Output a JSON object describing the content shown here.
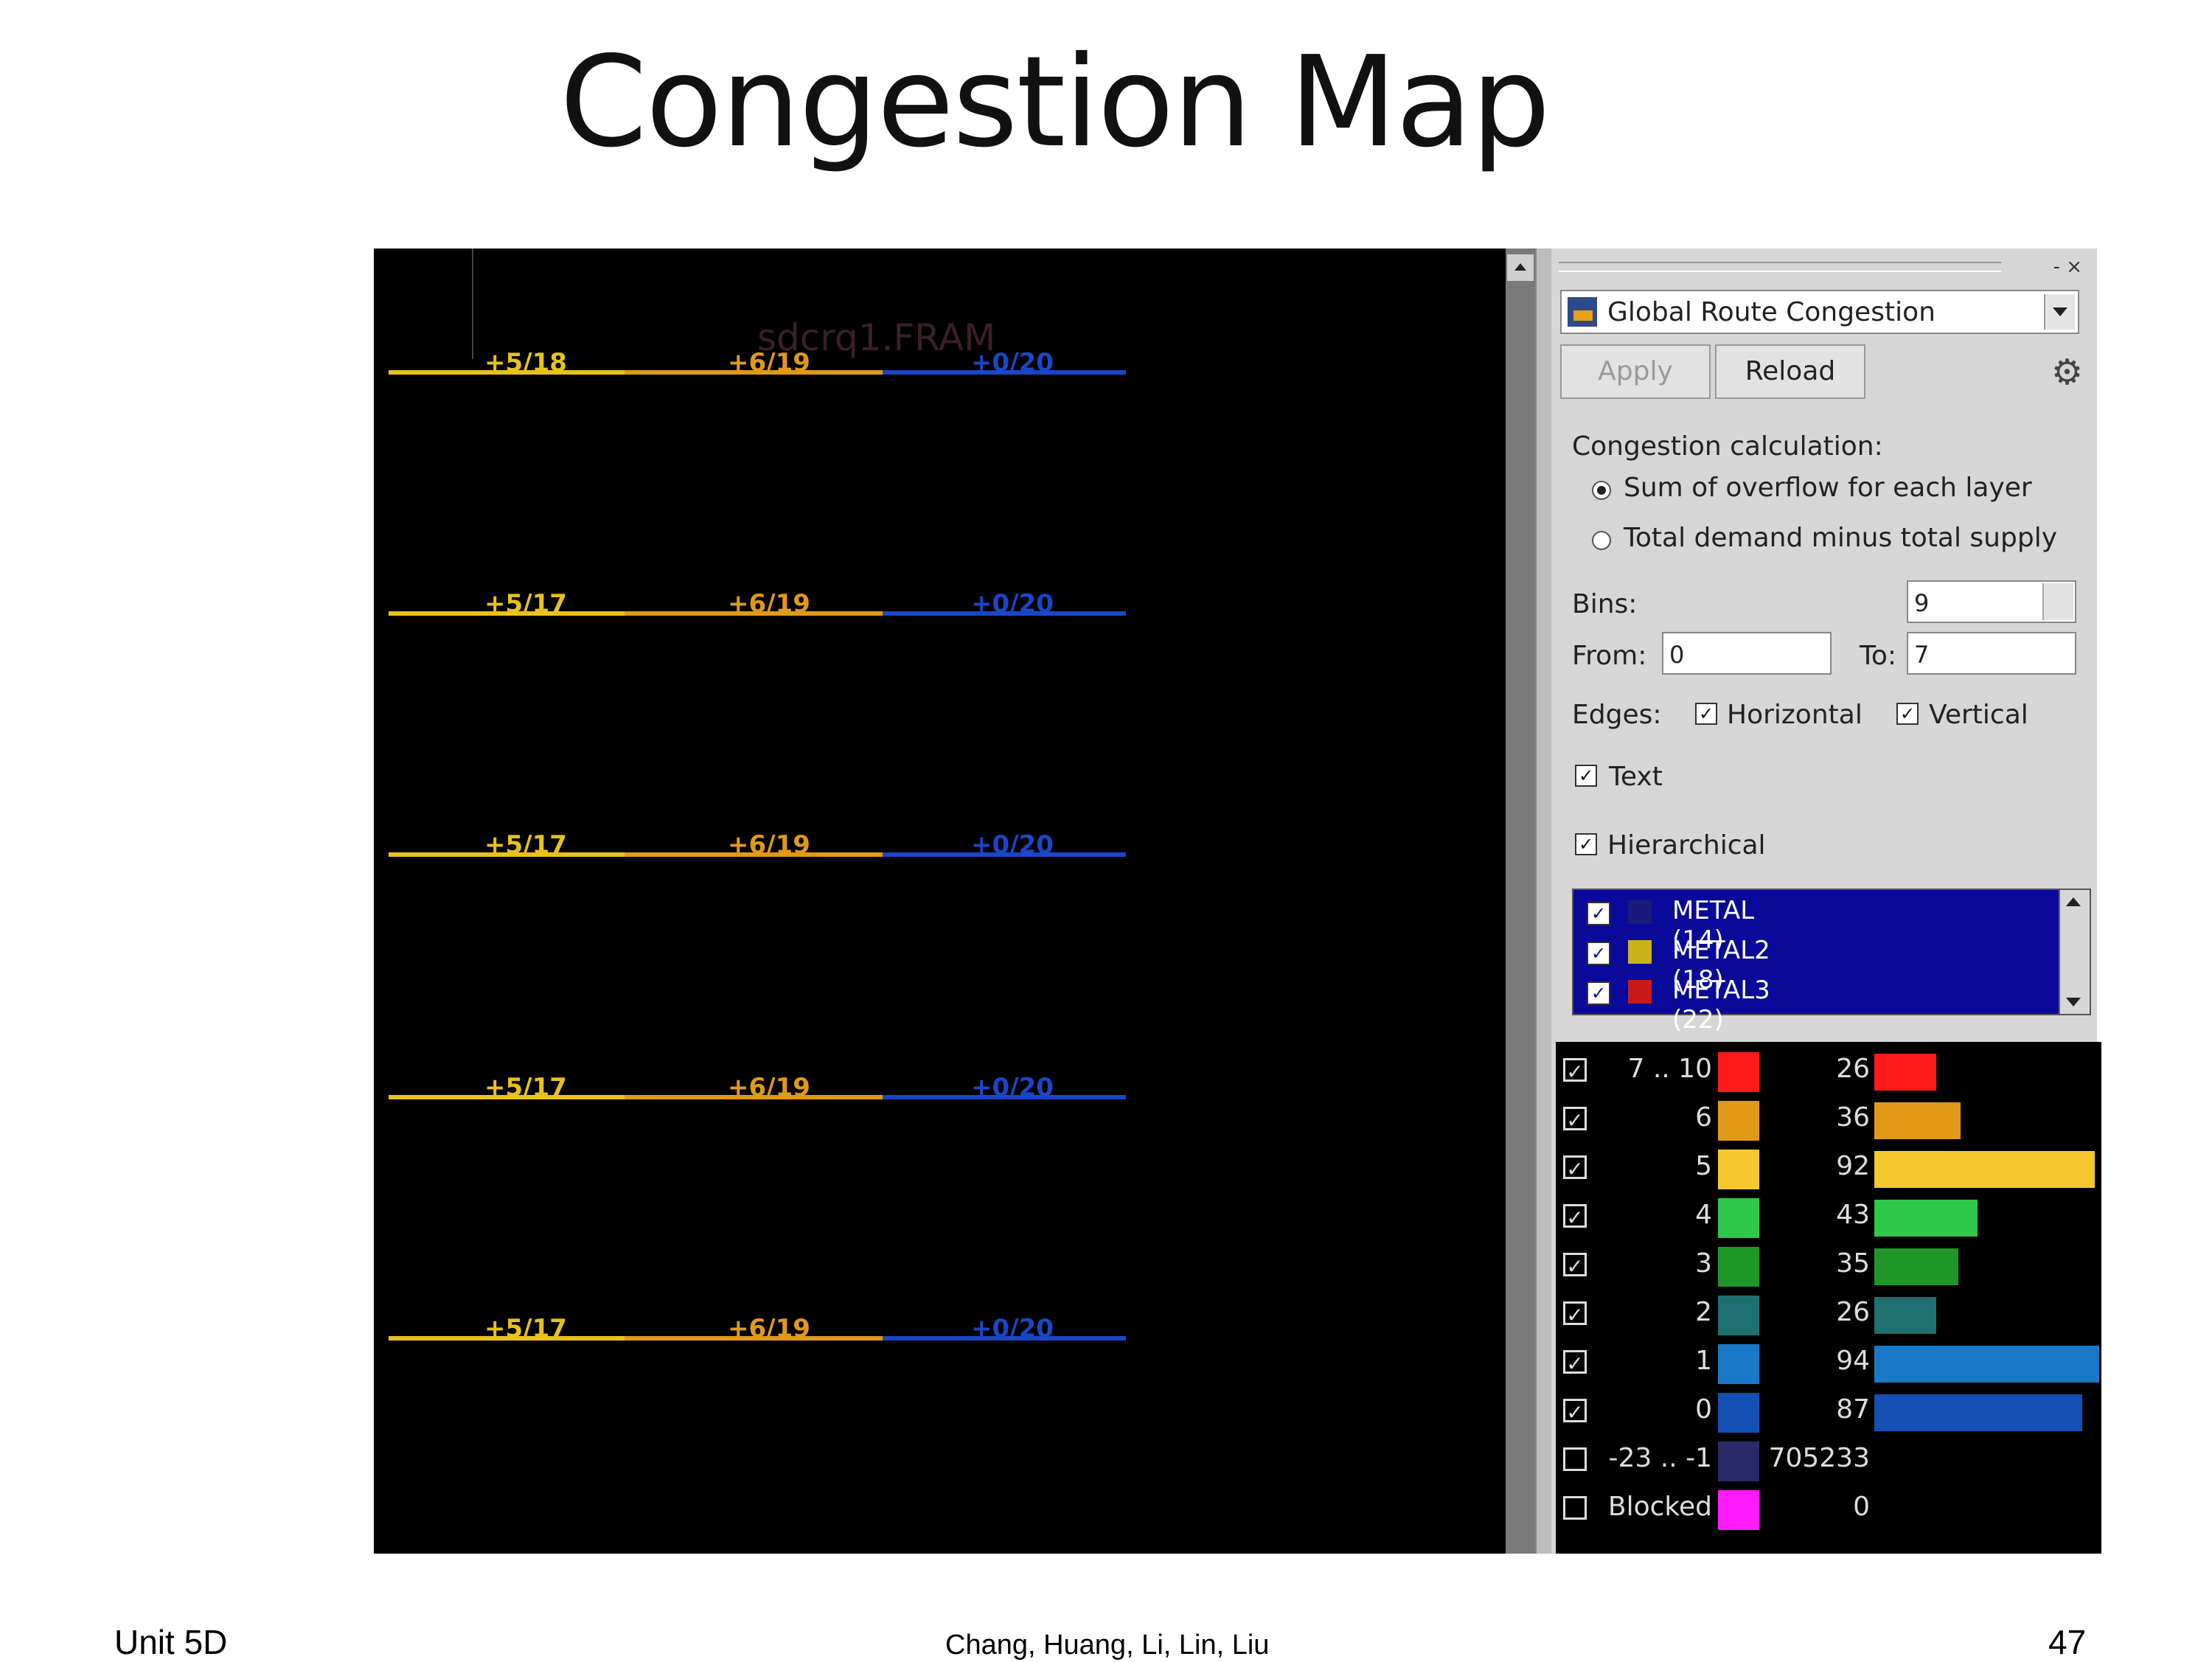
{
  "slide": {
    "title": "Congestion Map",
    "footer_left": "Unit 5D",
    "footer_center": "Chang, Huang, Li, Lin, Liu",
    "page_number": "47"
  },
  "canvas": {
    "cell_label": "sdcrq1.FRAM",
    "rows": [
      {
        "labels": [
          "+5/18",
          "+6/19",
          "+0/20"
        ]
      },
      {
        "labels": [
          "+5/17",
          "+6/19",
          "+0/20"
        ]
      },
      {
        "labels": [
          "+5/17",
          "+6/19",
          "+0/20"
        ]
      },
      {
        "labels": [
          "+5/17",
          "+6/19",
          "+0/20"
        ]
      },
      {
        "labels": [
          "+5/17",
          "+6/19",
          "+0/20"
        ]
      }
    ],
    "segment_colors": [
      "#e8c21a",
      "#e09a18",
      "#1a46c8"
    ]
  },
  "panel": {
    "window_buttons": "- ×",
    "map_select": "Global Route Congestion",
    "apply_label": "Apply",
    "reload_label": "Reload",
    "settings_icon": "gear-icon",
    "calc_heading": "Congestion calculation:",
    "calc_options": [
      "Sum of overflow for each layer",
      "Total demand minus total supply"
    ],
    "calc_selected": 0,
    "bins_label": "Bins:",
    "bins_value": "9",
    "from_label": "From:",
    "from_value": "0",
    "to_label": "To:",
    "to_value": "7",
    "edges_label": "Edges:",
    "horizontal_label": "Horizontal",
    "horizontal_checked": true,
    "vertical_label": "Vertical",
    "vertical_checked": true,
    "text_label": "Text",
    "text_checked": true,
    "hierarchical_label": "Hierarchical",
    "hierarchical_checked": true,
    "layers": [
      {
        "name": "METAL (14)",
        "checked": true,
        "color": "#1a1a7a"
      },
      {
        "name": "METAL2 (18)",
        "checked": true,
        "color": "#c8b41a"
      },
      {
        "name": "METAL3 (22)",
        "checked": true,
        "color": "#c81a1a"
      }
    ]
  },
  "legend": [
    {
      "range": "7 .. 10",
      "count": "26",
      "count_value": 26,
      "color": "#ff1a1a",
      "checked": true
    },
    {
      "range": "6",
      "count": "36",
      "count_value": 36,
      "color": "#e09a18",
      "checked": true
    },
    {
      "range": "5",
      "count": "92",
      "count_value": 92,
      "color": "#f5c830",
      "checked": true
    },
    {
      "range": "4",
      "count": "43",
      "count_value": 43,
      "color": "#2ec84a",
      "checked": true
    },
    {
      "range": "3",
      "count": "35",
      "count_value": 35,
      "color": "#1e9628",
      "checked": true
    },
    {
      "range": "2",
      "count": "26",
      "count_value": 26,
      "color": "#1e7070",
      "checked": true
    },
    {
      "range": "1",
      "count": "94",
      "count_value": 94,
      "color": "#1a78c8",
      "checked": true
    },
    {
      "range": "0",
      "count": "87",
      "count_value": 87,
      "color": "#1450b4",
      "checked": true
    },
    {
      "range": "-23 .. -1",
      "count": "705233",
      "count_value": 705233,
      "color": "#2a2a6a",
      "checked": false
    },
    {
      "range": "Blocked",
      "count": "0",
      "count_value": 0,
      "color": "#ff1aff",
      "checked": false
    }
  ]
}
